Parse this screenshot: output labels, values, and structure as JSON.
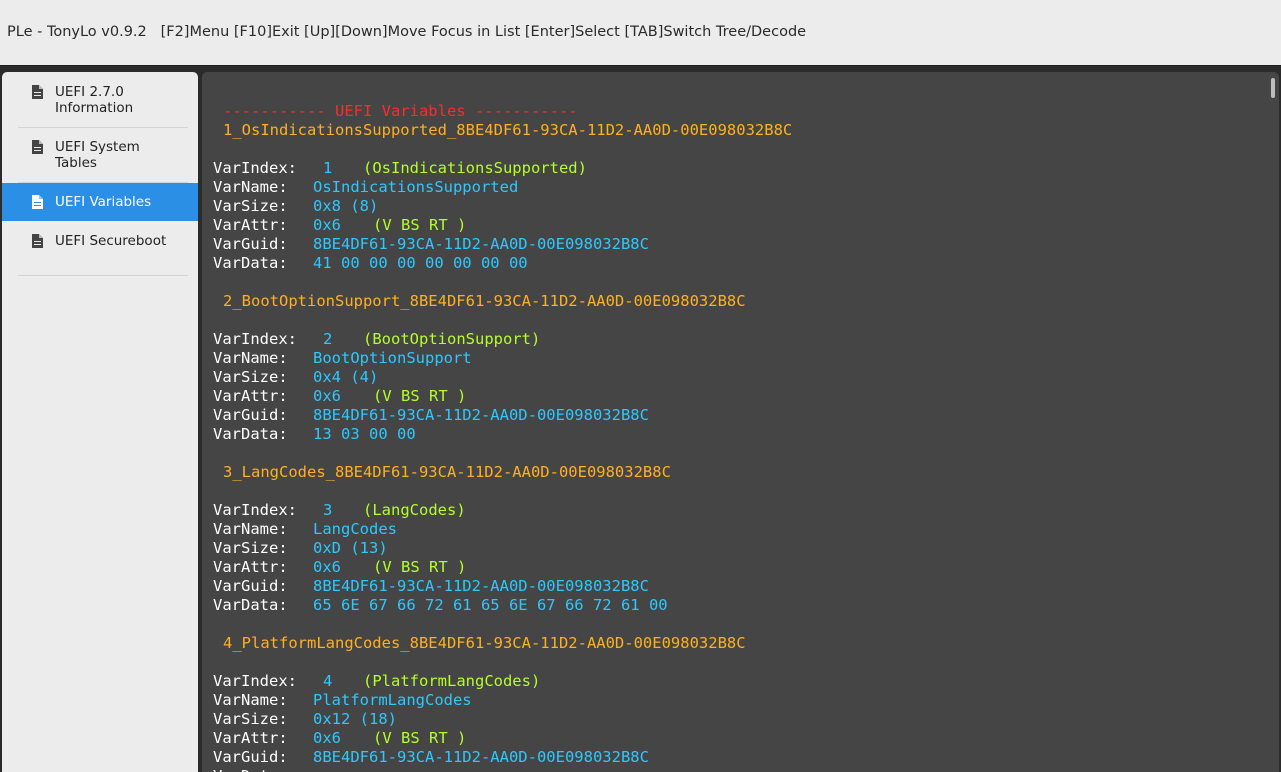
{
  "titlebar": {
    "text": "PLe - TonyLo v0.9.2   [F2]Menu [F10]Exit [Up][Down]Move Focus in List [Enter]Select [TAB]Switch Tree/Decode"
  },
  "sidebar": {
    "items": [
      {
        "label": "UEFI 2.7.0 Information",
        "icon": "file-icon",
        "selected": false
      },
      {
        "label": "UEFI System Tables",
        "icon": "file-icon",
        "selected": false
      },
      {
        "label": "UEFI Variables",
        "icon": "file-icon",
        "selected": true
      },
      {
        "label": "UEFI Secureboot",
        "icon": "file-icon",
        "selected": false
      }
    ]
  },
  "content": {
    "header": "----------- UEFI Variables -----------",
    "labels": {
      "index": "VarIndex:",
      "name": "VarName:",
      "size": "VarSize:",
      "attr": "VarAttr:",
      "guid": "VarGuid:",
      "data": "VarData:"
    },
    "variables": [
      {
        "title": "1_OsIndicationsSupported_8BE4DF61-93CA-11D2-AA0D-00E098032B8C",
        "index": "1",
        "index_name": "(OsIndicationsSupported)",
        "name": "OsIndicationsSupported",
        "size": "0x8 (8)",
        "attr": "0x6",
        "attr_flags": "(V BS RT )",
        "guid": "8BE4DF61-93CA-11D2-AA0D-00E098032B8C",
        "data": "41 00 00 00 00 00 00 00"
      },
      {
        "title": "2_BootOptionSupport_8BE4DF61-93CA-11D2-AA0D-00E098032B8C",
        "index": "2",
        "index_name": "(BootOptionSupport)",
        "name": "BootOptionSupport",
        "size": "0x4 (4)",
        "attr": "0x6",
        "attr_flags": "(V BS RT )",
        "guid": "8BE4DF61-93CA-11D2-AA0D-00E098032B8C",
        "data": "13 03 00 00"
      },
      {
        "title": "3_LangCodes_8BE4DF61-93CA-11D2-AA0D-00E098032B8C",
        "index": "3",
        "index_name": "(LangCodes)",
        "name": "LangCodes",
        "size": "0xD (13)",
        "attr": "0x6",
        "attr_flags": "(V BS RT )",
        "guid": "8BE4DF61-93CA-11D2-AA0D-00E098032B8C",
        "data": "65 6E 67 66 72 61 65 6E 67 66 72 61 00"
      },
      {
        "title": "4_PlatformLangCodes_8BE4DF61-93CA-11D2-AA0D-00E098032B8C",
        "index": "4",
        "index_name": "(PlatformLangCodes)",
        "name": "PlatformLangCodes",
        "size": "0x12 (18)",
        "attr": "0x6",
        "attr_flags": "(V BS RT )",
        "guid": "8BE4DF61-93CA-11D2-AA0D-00E098032B8C",
        "data": ""
      }
    ]
  }
}
